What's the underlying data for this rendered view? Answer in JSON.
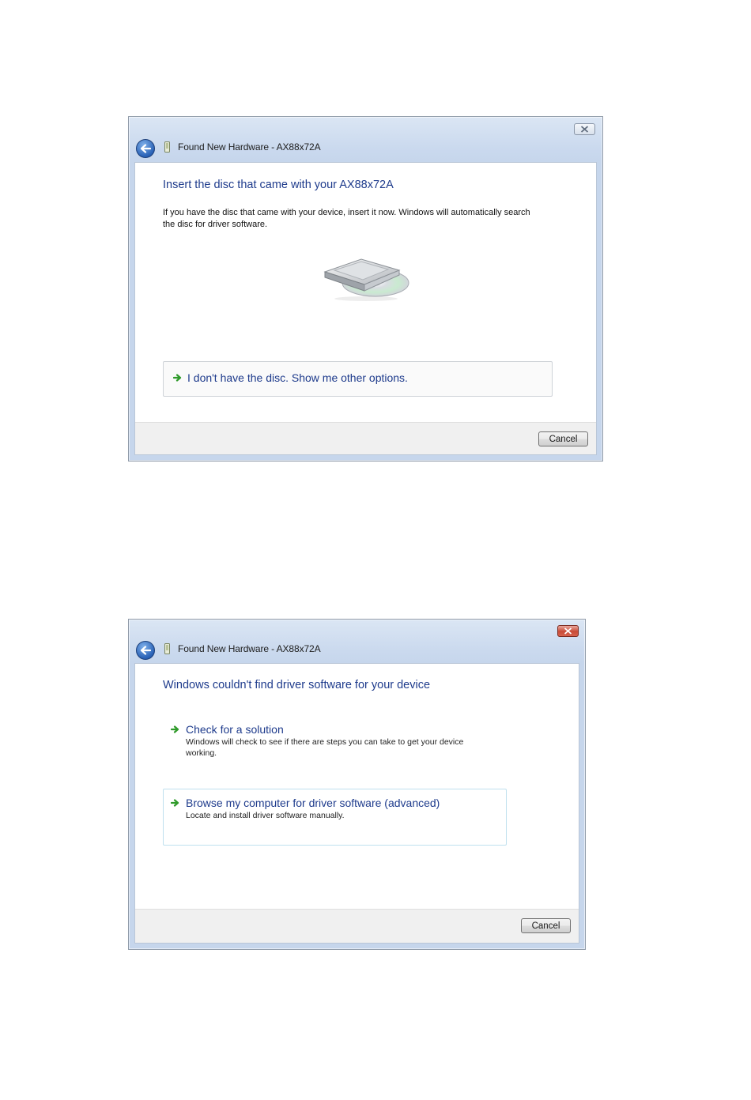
{
  "dialog1": {
    "title": "Found New Hardware - AX88x72A",
    "heading": "Insert the disc that came with your AX88x72A",
    "body": "If you have the disc that came with your device, insert it now.  Windows will automatically search the disc for driver software.",
    "option_label": "I don't have the disc.  Show me other options.",
    "cancel_label": "Cancel"
  },
  "dialog2": {
    "title": "Found New Hardware - AX88x72A",
    "heading": "Windows couldn't find driver software for your device",
    "options": [
      {
        "label": "Check for a solution",
        "description": "Windows will check to see if there are steps you can take to get your device working."
      },
      {
        "label": "Browse my computer for driver software (advanced)",
        "description": "Locate and install driver software manually."
      }
    ],
    "cancel_label": "Cancel"
  },
  "colors": {
    "heading_blue": "#1e3b8c",
    "arrow_green": "#2f9a2a",
    "frame_blue": "#c6d6ec"
  },
  "icons": {
    "back": "back-arrow-icon",
    "hardware": "usb-device-icon",
    "disc": "optical-drive-icon",
    "option_arrow": "green-arrow-icon",
    "close": "close-icon"
  }
}
